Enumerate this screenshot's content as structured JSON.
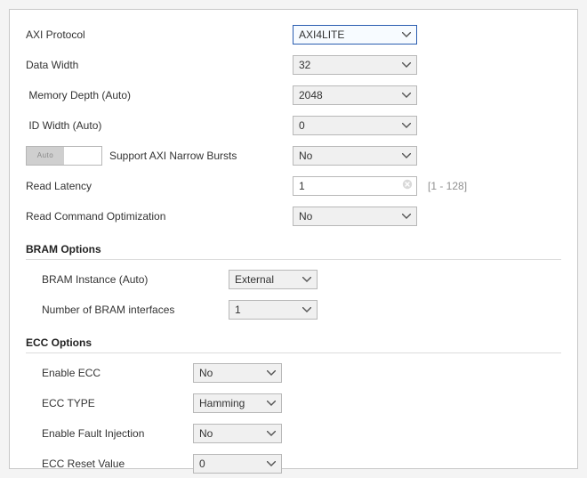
{
  "fields": {
    "axi_protocol": {
      "label": "AXI Protocol",
      "value": "AXI4LITE"
    },
    "data_width": {
      "label": "Data Width",
      "value": "32"
    },
    "memory_depth": {
      "label": "Memory Depth (Auto)",
      "value": "2048"
    },
    "id_width": {
      "label": "ID Width (Auto)",
      "value": "0"
    },
    "narrow_bursts": {
      "label": "Support AXI Narrow Bursts",
      "value": "No",
      "toggle_text": "Auto"
    },
    "read_latency": {
      "label": "Read Latency",
      "value": "1",
      "hint": "[1 - 128]"
    },
    "read_cmd_opt": {
      "label": "Read Command Optimization",
      "value": "No"
    }
  },
  "bram": {
    "title": "BRAM Options",
    "instance": {
      "label": "BRAM Instance (Auto)",
      "value": "External"
    },
    "num_if": {
      "label": "Number of BRAM interfaces",
      "value": "1"
    }
  },
  "ecc": {
    "title": "ECC Options",
    "enable": {
      "label": "Enable ECC",
      "value": "No"
    },
    "type": {
      "label": "ECC TYPE",
      "value": "Hamming"
    },
    "fault": {
      "label": "Enable Fault Injection",
      "value": "No"
    },
    "reset": {
      "label": "ECC Reset Value",
      "value": "0"
    }
  }
}
